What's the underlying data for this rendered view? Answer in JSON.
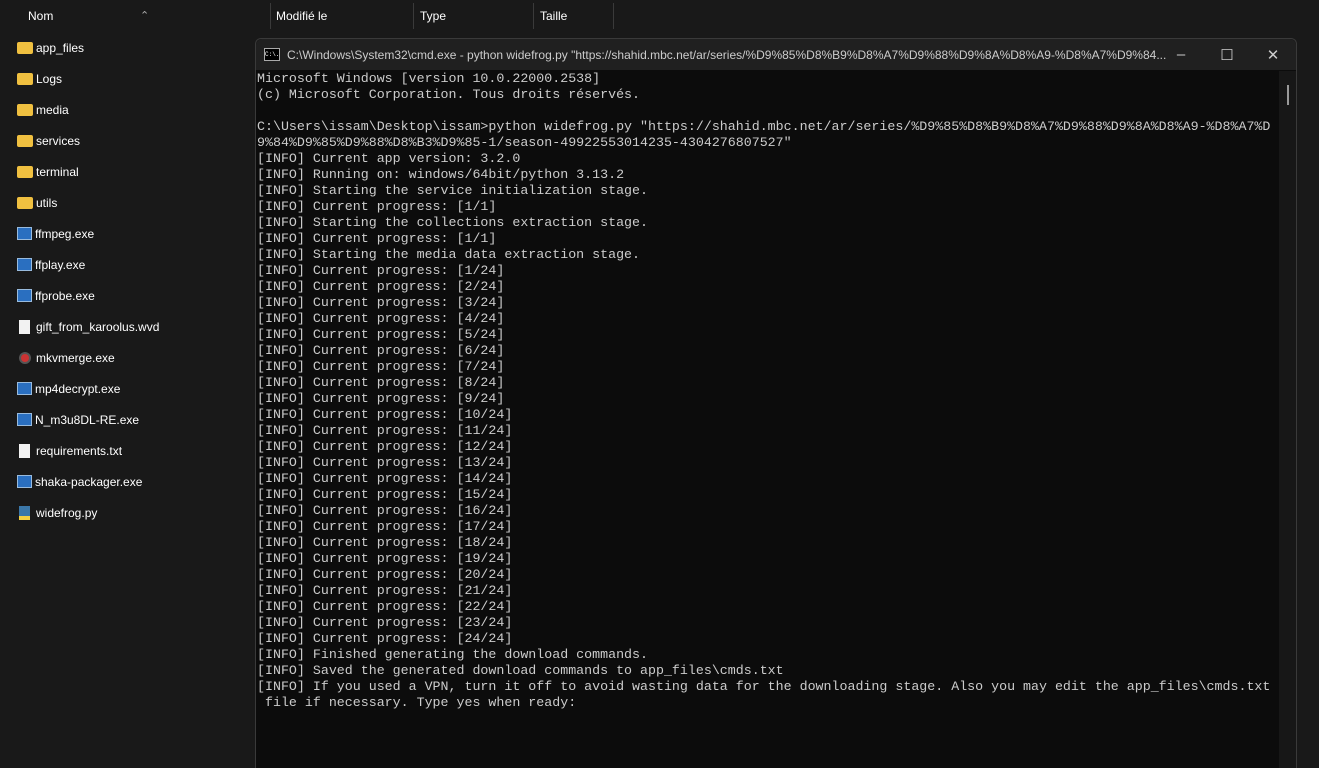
{
  "explorer": {
    "columns": [
      "Nom",
      "Modifié le",
      "Type",
      "Taille"
    ],
    "files": [
      {
        "name": "app_files",
        "icon": "folder"
      },
      {
        "name": "Logs",
        "icon": "folder"
      },
      {
        "name": "media",
        "icon": "folder"
      },
      {
        "name": "services",
        "icon": "folder"
      },
      {
        "name": "terminal",
        "icon": "folder"
      },
      {
        "name": "utils",
        "icon": "folder"
      },
      {
        "name": "ffmpeg.exe",
        "icon": "exe"
      },
      {
        "name": "ffplay.exe",
        "icon": "exe"
      },
      {
        "name": "ffprobe.exe",
        "icon": "exe"
      },
      {
        "name": "gift_from_karoolus.wvd",
        "icon": "doc"
      },
      {
        "name": "mkvmerge.exe",
        "icon": "mkv"
      },
      {
        "name": "mp4decrypt.exe",
        "icon": "exe"
      },
      {
        "name": "N_m3u8DL-RE.exe",
        "icon": "exe"
      },
      {
        "name": "requirements.txt",
        "icon": "doc"
      },
      {
        "name": "shaka-packager.exe",
        "icon": "exe"
      },
      {
        "name": "widefrog.py",
        "icon": "py"
      }
    ]
  },
  "terminal": {
    "title": "C:\\Windows\\System32\\cmd.exe - python  widefrog.py \"https://shahid.mbc.net/ar/series/%D9%85%D8%B9%D8%A7%D9%88%D9%8A%D8%A9-%D8%A7%D9%84...",
    "lines": [
      "Microsoft Windows [version 10.0.22000.2538]",
      "(c) Microsoft Corporation. Tous droits réservés.",
      "",
      "C:\\Users\\issam\\Desktop\\issam>python widefrog.py \"https://shahid.mbc.net/ar/series/%D9%85%D8%B9%D8%A7%D9%88%D9%8A%D8%A9-%D8%A7%D",
      "9%84%D9%85%D9%88%D8%B3%D9%85-1/season-49922553014235-4304276807527\"",
      "[INFO] Current app version: 3.2.0",
      "[INFO] Running on: windows/64bit/python 3.13.2",
      "[INFO] Starting the service initialization stage.",
      "[INFO] Current progress: [1/1]",
      "[INFO] Starting the collections extraction stage.",
      "[INFO] Current progress: [1/1]",
      "[INFO] Starting the media data extraction stage.",
      "[INFO] Current progress: [1/24]",
      "[INFO] Current progress: [2/24]",
      "[INFO] Current progress: [3/24]",
      "[INFO] Current progress: [4/24]",
      "[INFO] Current progress: [5/24]",
      "[INFO] Current progress: [6/24]",
      "[INFO] Current progress: [7/24]",
      "[INFO] Current progress: [8/24]",
      "[INFO] Current progress: [9/24]",
      "[INFO] Current progress: [10/24]",
      "[INFO] Current progress: [11/24]",
      "[INFO] Current progress: [12/24]",
      "[INFO] Current progress: [13/24]",
      "[INFO] Current progress: [14/24]",
      "[INFO] Current progress: [15/24]",
      "[INFO] Current progress: [16/24]",
      "[INFO] Current progress: [17/24]",
      "[INFO] Current progress: [18/24]",
      "[INFO] Current progress: [19/24]",
      "[INFO] Current progress: [20/24]",
      "[INFO] Current progress: [21/24]",
      "[INFO] Current progress: [22/24]",
      "[INFO] Current progress: [23/24]",
      "[INFO] Current progress: [24/24]",
      "[INFO] Finished generating the download commands.",
      "[INFO] Saved the generated download commands to app_files\\cmds.txt",
      "[INFO] If you used a VPN, turn it off to avoid wasting data for the downloading stage. Also you may edit the app_files\\cmds.txt",
      " file if necessary. Type yes when ready:"
    ],
    "controls": {
      "minimize": "–",
      "maximize": "☐",
      "close": "✕"
    },
    "icon_label": "C:\\."
  }
}
